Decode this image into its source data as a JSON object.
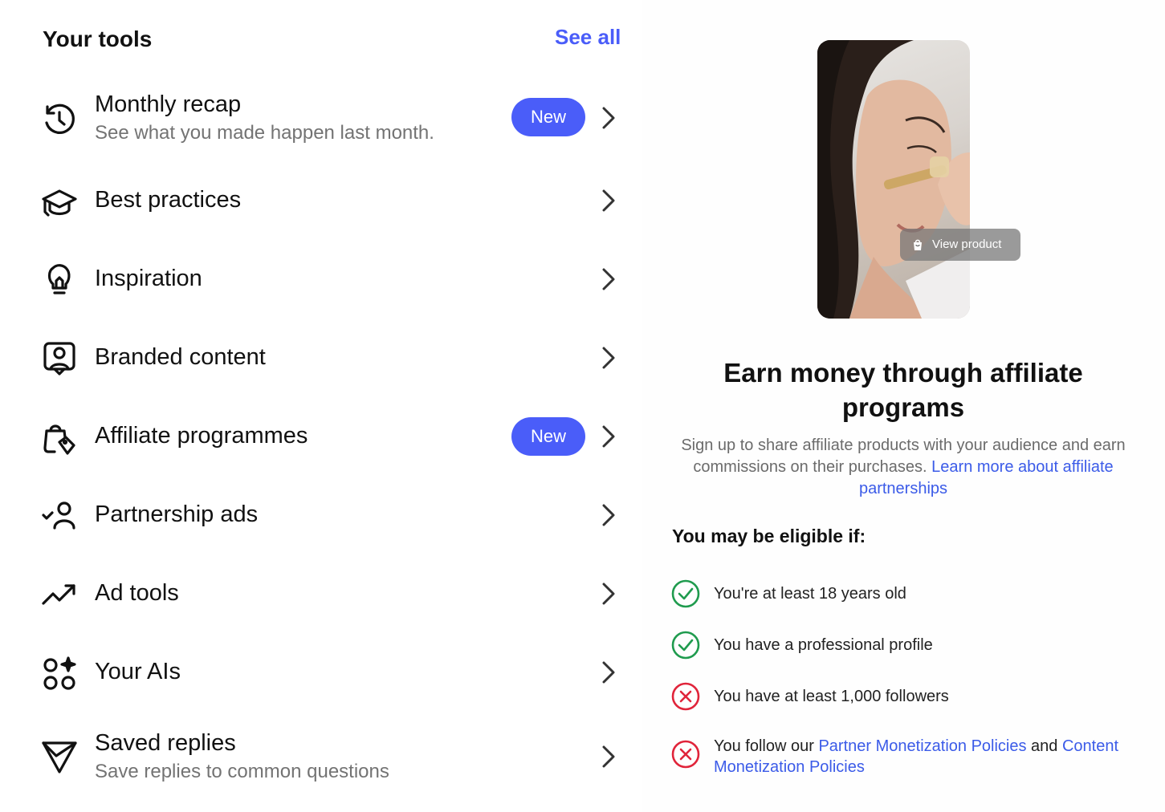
{
  "tools": {
    "title": "Your tools",
    "see_all": "See all",
    "items": [
      {
        "icon": "history-clock-icon",
        "label": "Monthly recap",
        "subtitle": "See what you made happen last month.",
        "badge": "New"
      },
      {
        "icon": "graduation-cap-icon",
        "label": "Best practices"
      },
      {
        "icon": "lightbulb-icon",
        "label": "Inspiration"
      },
      {
        "icon": "branded-content-icon",
        "label": "Branded content"
      },
      {
        "icon": "shopping-bag-tag-icon",
        "label": "Affiliate programmes",
        "badge": "New"
      },
      {
        "icon": "person-check-icon",
        "label": "Partnership ads"
      },
      {
        "icon": "trending-up-icon",
        "label": "Ad tools"
      },
      {
        "icon": "ai-sparkle-icon",
        "label": "Your AIs"
      },
      {
        "icon": "send-icon",
        "label": "Saved replies",
        "subtitle": "Save replies to common questions"
      }
    ]
  },
  "affiliate": {
    "view_product": "View product",
    "title": "Earn money through affiliate programs",
    "description": "Sign up to share affiliate products with your audience and earn commissions on their purchases.",
    "learn_more": "Learn more about affiliate partnerships",
    "eligibility_title": "You may be eligible if:",
    "criteria": [
      {
        "status": "met",
        "text": "You're at least 18 years old"
      },
      {
        "status": "met",
        "text": "You have a professional profile"
      },
      {
        "status": "not-met",
        "text": "You have at least 1,000 followers"
      },
      {
        "status": "not-met",
        "text_prefix": "You follow our",
        "link1": "Partner Monetization Policies",
        "text_mid": "and",
        "link2": "Content Monetization Policies"
      }
    ]
  },
  "colors": {
    "accent": "#4a5df9",
    "link": "#3b5be8",
    "check_green": "#1f9b4e",
    "cross_red": "#e0243a"
  }
}
